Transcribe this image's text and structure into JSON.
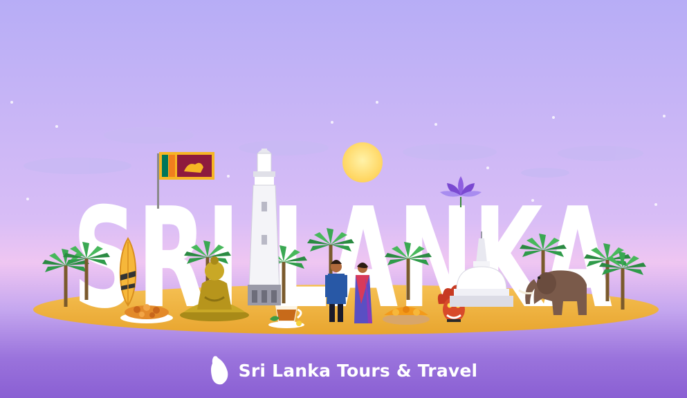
{
  "headline": "SRI LANKA",
  "footer": {
    "caption": "Sri Lanka Tours & Travel",
    "icon": "sri-lanka-island-icon"
  },
  "colors": {
    "sky_top": "#b9acf6",
    "sky_bottom": "#e4bdf4",
    "sand": "#f0b33c",
    "sea": "#8f68d6",
    "sun": "#ffd86a",
    "letters": "#ffffff"
  },
  "scene_objects": [
    "flag-icon",
    "surfboard-icon",
    "food-plate-icon",
    "buddha-statue-icon",
    "lighthouse-icon",
    "tea-cup-icon",
    "man-figure-icon",
    "woman-figure-icon",
    "lotus-icon",
    "spice-bowl-icon",
    "demon-mask-icon",
    "stupa-icon",
    "elephant-icon",
    "palm-tree-icon",
    "sun-icon"
  ]
}
